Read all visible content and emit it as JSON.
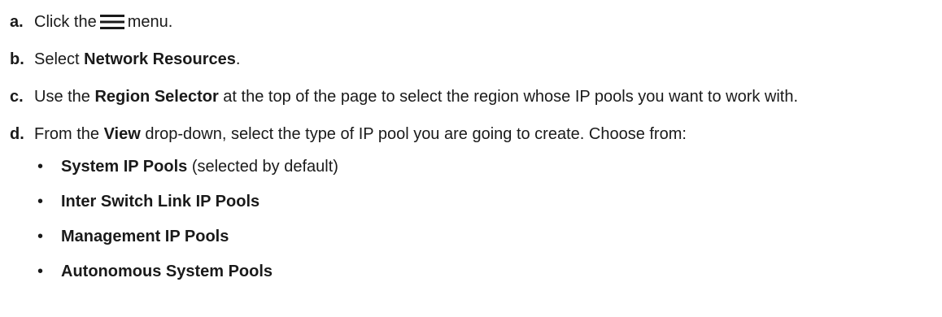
{
  "steps": [
    {
      "letter": "a.",
      "before_icon": "Click the",
      "icon": "hamburger-menu-icon",
      "after_icon": "menu."
    },
    {
      "letter": "b.",
      "text_before": "Select ",
      "bold": "Network Resources",
      "text_after": "."
    },
    {
      "letter": "c.",
      "text_before": "Use the ",
      "bold": "Region Selector",
      "text_after": " at the top of the page to select the region whose IP pools you want to work with."
    },
    {
      "letter": "d.",
      "text_before": "From the ",
      "bold": "View",
      "text_after": " drop-down, select the type of IP pool you are going to create. Choose from:"
    }
  ],
  "pool_types": [
    {
      "bullet": "•",
      "bold": "System IP Pools",
      "note": " (selected by default)"
    },
    {
      "bullet": "•",
      "bold": "Inter Switch Link IP Pools",
      "note": ""
    },
    {
      "bullet": "•",
      "bold": "Management IP Pools",
      "note": ""
    },
    {
      "bullet": "•",
      "bold": "Autonomous System Pools",
      "note": ""
    }
  ]
}
